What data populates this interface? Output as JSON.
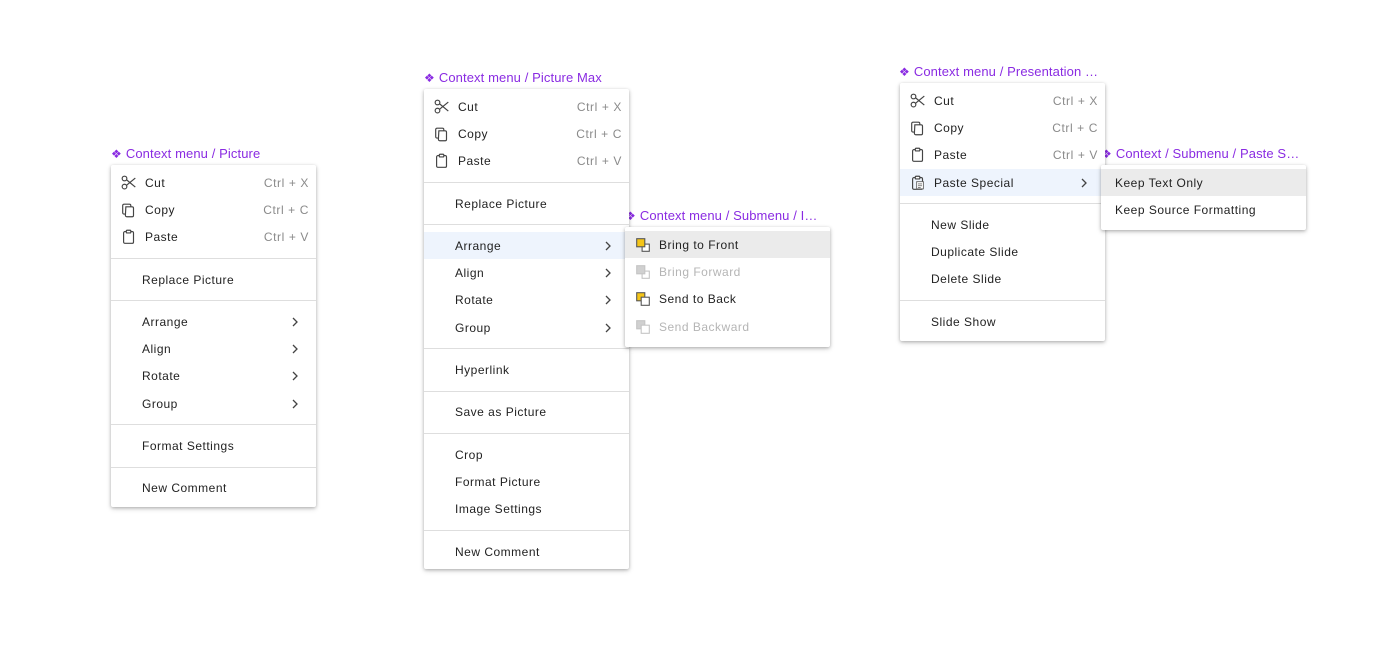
{
  "menu1": {
    "title": "Context menu / Picture",
    "items": {
      "cut": {
        "label": "Cut",
        "shortcut": "Ctrl + X",
        "icon": "scissors-icon"
      },
      "copy": {
        "label": "Copy",
        "shortcut": "Ctrl + C",
        "icon": "copy-icon"
      },
      "paste": {
        "label": "Paste",
        "shortcut": "Ctrl + V",
        "icon": "clipboard-icon"
      },
      "replace": {
        "label": "Replace Picture"
      },
      "arrange": {
        "label": "Arrange"
      },
      "align": {
        "label": "Align"
      },
      "rotate": {
        "label": "Rotate"
      },
      "group": {
        "label": "Group"
      },
      "format_settings": {
        "label": "Format Settings"
      },
      "new_comment": {
        "label": "New Comment"
      }
    }
  },
  "menu2": {
    "title": "Context menu / Picture Max",
    "items": {
      "cut": {
        "label": "Cut",
        "shortcut": "Ctrl + X",
        "icon": "scissors-icon"
      },
      "copy": {
        "label": "Copy",
        "shortcut": "Ctrl + C",
        "icon": "copy-icon"
      },
      "paste": {
        "label": "Paste",
        "shortcut": "Ctrl + V",
        "icon": "clipboard-icon"
      },
      "replace": {
        "label": "Replace Picture"
      },
      "arrange": {
        "label": "Arrange"
      },
      "align": {
        "label": "Align"
      },
      "rotate": {
        "label": "Rotate"
      },
      "group": {
        "label": "Group"
      },
      "hyperlink": {
        "label": "Hyperlink"
      },
      "save_as": {
        "label": "Save as Picture"
      },
      "crop": {
        "label": "Crop"
      },
      "format_picture": {
        "label": "Format Picture"
      },
      "image_settings": {
        "label": "Image Settings"
      },
      "new_comment": {
        "label": "New Comment"
      }
    }
  },
  "menu3": {
    "title": "Context menu / Submenu / Image Arrange",
    "items": {
      "bring_front": {
        "label": "Bring to Front",
        "icon": "bring-to-front-icon"
      },
      "bring_forward": {
        "label": "Bring Forward",
        "icon": "bring-forward-icon"
      },
      "send_back": {
        "label": "Send to Back",
        "icon": "send-to-back-icon"
      },
      "send_backward": {
        "label": "Send Backward",
        "icon": "send-backward-icon"
      }
    }
  },
  "menu4": {
    "title": "Context menu / Presentation Slide",
    "items": {
      "cut": {
        "label": "Cut",
        "shortcut": "Ctrl + X",
        "icon": "scissors-icon"
      },
      "copy": {
        "label": "Copy",
        "shortcut": "Ctrl + C",
        "icon": "copy-icon"
      },
      "paste": {
        "label": "Paste",
        "shortcut": "Ctrl + V",
        "icon": "clipboard-icon"
      },
      "paste_special": {
        "label": "Paste Special",
        "icon": "paste-special-icon"
      },
      "new_slide": {
        "label": "New Slide"
      },
      "duplicate_slide": {
        "label": "Duplicate Slide"
      },
      "delete_slide": {
        "label": "Delete Slide"
      },
      "slide_show": {
        "label": "Slide Show"
      }
    }
  },
  "menu5": {
    "title": "Context / Submenu / Paste Special",
    "items": {
      "keep_text": {
        "label": "Keep Text Only"
      },
      "keep_source": {
        "label": "Keep Source Formatting"
      }
    }
  },
  "colors": {
    "frame_label": "#8a2be2",
    "highlight_row": "#eef4fd",
    "hover_row": "#ebebeb",
    "shortcut_text": "#8a8a8a",
    "disabled_text": "#b5b5b5",
    "arrange_icon_accent": "#f5c518"
  },
  "glyphs": {
    "frame_marker": "❖"
  }
}
